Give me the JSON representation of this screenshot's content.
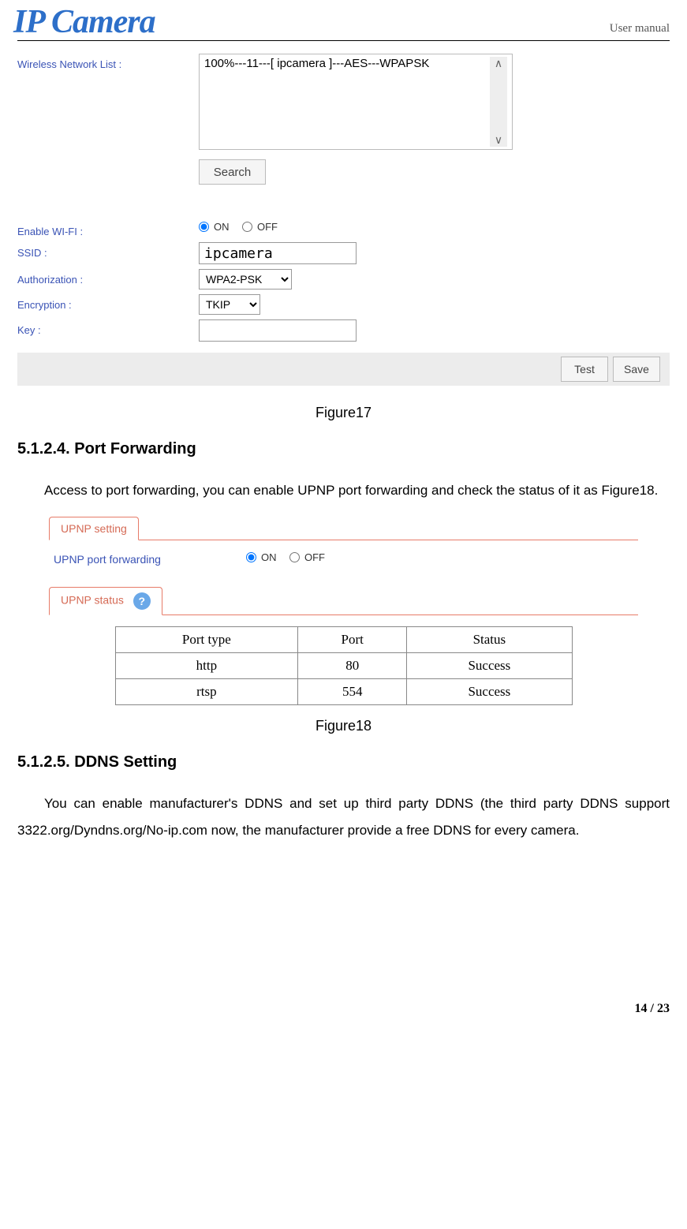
{
  "header": {
    "logo_text": "IP Camera",
    "right_text": "User manual"
  },
  "fig17": {
    "wifi_list_label": "Wireless Network List :",
    "list_item": "100%---11---[ ipcamera ]---AES---WPAPSK",
    "search_btn": "Search",
    "enable_label": "Enable WI-FI :",
    "on_label": "ON",
    "off_label": "OFF",
    "ssid_label": "SSID :",
    "ssid_value": "ipcamera",
    "auth_label": "Authorization :",
    "auth_value": "WPA2-PSK",
    "enc_label": "Encryption :",
    "enc_value": "TKIP",
    "key_label": "Key :",
    "footer_test": "Test",
    "footer_save": "Save",
    "caption": "Figure17"
  },
  "s5124": {
    "heading": "5.1.2.4. Port Forwarding",
    "body": "Access to port forwarding, you can enable UPNP port forwarding and check the status of it as Figure18."
  },
  "fig18": {
    "tab_setting": "UPNP setting",
    "upnp_pf_label": "UPNP port forwarding",
    "on_label": "ON",
    "off_label": "OFF",
    "tab_status": "UPNP status",
    "table": {
      "h1": "Port type",
      "h2": "Port",
      "h3": "Status",
      "r1c1": "http",
      "r1c2": "80",
      "r1c3": "Success",
      "r2c1": "rtsp",
      "r2c2": "554",
      "r2c3": "Success"
    },
    "caption": "Figure18"
  },
  "s5125": {
    "heading": "5.1.2.5. DDNS Setting",
    "body": "You can enable manufacturer's DDNS and set up third party DDNS (the third party DDNS support 3322.org/Dyndns.org/No-ip.com now, the manufacturer provide a free DDNS for every camera."
  },
  "footer": {
    "page": "14 / 23"
  },
  "chart_data": {
    "type": "table",
    "title": "UPNP status",
    "columns": [
      "Port type",
      "Port",
      "Status"
    ],
    "rows": [
      [
        "http",
        80,
        "Success"
      ],
      [
        "rtsp",
        554,
        "Success"
      ]
    ]
  }
}
